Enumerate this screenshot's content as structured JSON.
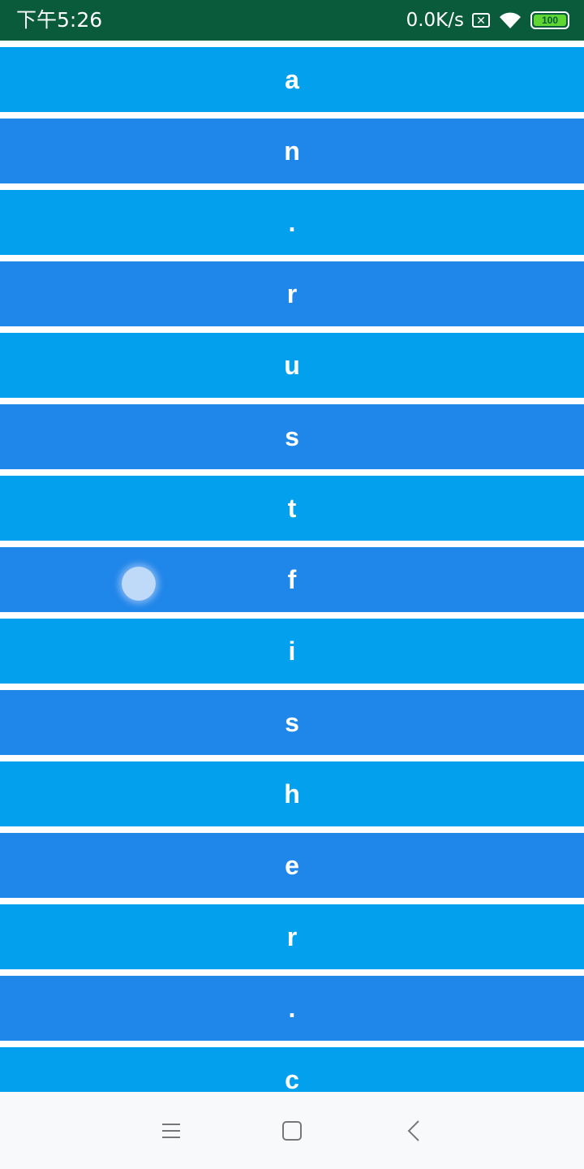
{
  "status_bar": {
    "time": "下午5:26",
    "net_speed": "0.0K/s",
    "sim_icon": "sim-x-icon",
    "wifi_icon": "wifi-icon",
    "battery_level": "100",
    "battery_color": "#5fd632"
  },
  "list": {
    "colors": {
      "light": "#03a0ee",
      "dark": "#1f86ea"
    },
    "items": [
      "a",
      "n",
      ".",
      "r",
      "u",
      "s",
      "t",
      "f",
      "i",
      "s",
      "h",
      "e",
      "r",
      ".",
      "c"
    ]
  },
  "nav_bar": {
    "menu_icon": "menu-icon",
    "home_icon": "home-icon",
    "back_icon": "back-icon"
  }
}
